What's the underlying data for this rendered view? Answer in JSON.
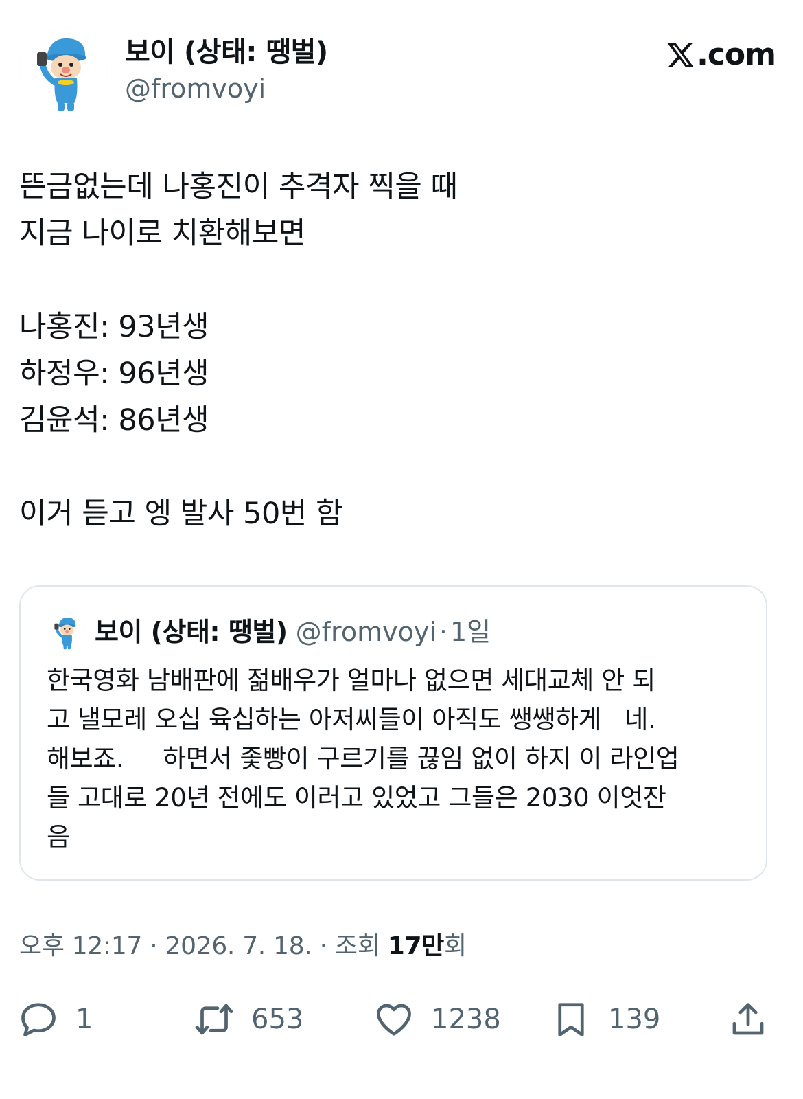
{
  "author": {
    "name": "보이 (상태: 땡벌)",
    "handle": "@fromvoyi",
    "avatar_icon": "pocoyo-avatar-icon"
  },
  "brand": {
    "text": ".com",
    "icon": "x-logo-icon"
  },
  "tweet": {
    "lines": [
      "뜬금없는데 나홍진이 추격자 찍을 때",
      "지금 나이로 치환해보면",
      "",
      "나홍진: 93년생",
      "하정우: 96년생",
      "김윤석: 86년생",
      "",
      "이거 듣고 엥 발사 50번 함"
    ]
  },
  "quote": {
    "name": "보이 (상태: 땡벌)",
    "handle": "@fromvoyi",
    "separator": "·",
    "time": "1일",
    "lines": [
      "한국영화 남배판에 젊배우가 얼마나 없으면 세대교체 안 되",
      "고 낼모레 오십 육십하는 아저씨들이 아직도 쌩쌩하게   네.",
      "해보죠.     하면서 좇빵이 구르기를 끊임 없이 하지 이 라인업",
      "들 고대로 20년 전에도 이러고 있었고 그들은 2030 이엇잔",
      "음"
    ]
  },
  "stamp": {
    "time": "오후 12:17",
    "date": "2026. 7. 18.",
    "views_label": "조회",
    "views_num": "17만",
    "views_suffix": "회",
    "separator": "·"
  },
  "actions": {
    "reply": {
      "count": "1",
      "icon": "reply-icon"
    },
    "retweet": {
      "count": "653",
      "icon": "retweet-icon"
    },
    "like": {
      "count": "1238",
      "icon": "heart-icon"
    },
    "bookmark": {
      "count": "139",
      "icon": "bookmark-icon"
    },
    "share": {
      "icon": "share-icon"
    }
  },
  "colors": {
    "text": "#0f1419",
    "secondary": "#536471",
    "border": "#e1e6ea",
    "avatar_blue": "#3a9ad9"
  }
}
